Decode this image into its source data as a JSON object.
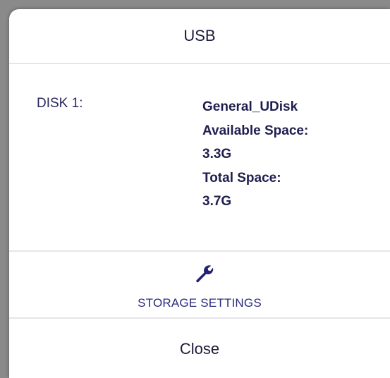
{
  "dialog": {
    "title": "USB"
  },
  "disk": {
    "label": "DISK 1:",
    "name": "General_UDisk",
    "available_label": "Available Space:",
    "available_value": "3.3G",
    "total_label": "Total Space:",
    "total_value": "3.7G"
  },
  "settings": {
    "icon": "wrench-icon",
    "label": "STORAGE SETTINGS"
  },
  "actions": {
    "close_label": "Close"
  },
  "colors": {
    "accent": "#2b2a7e",
    "text": "#1c1b3a",
    "overlay": "#8a8a8a"
  }
}
